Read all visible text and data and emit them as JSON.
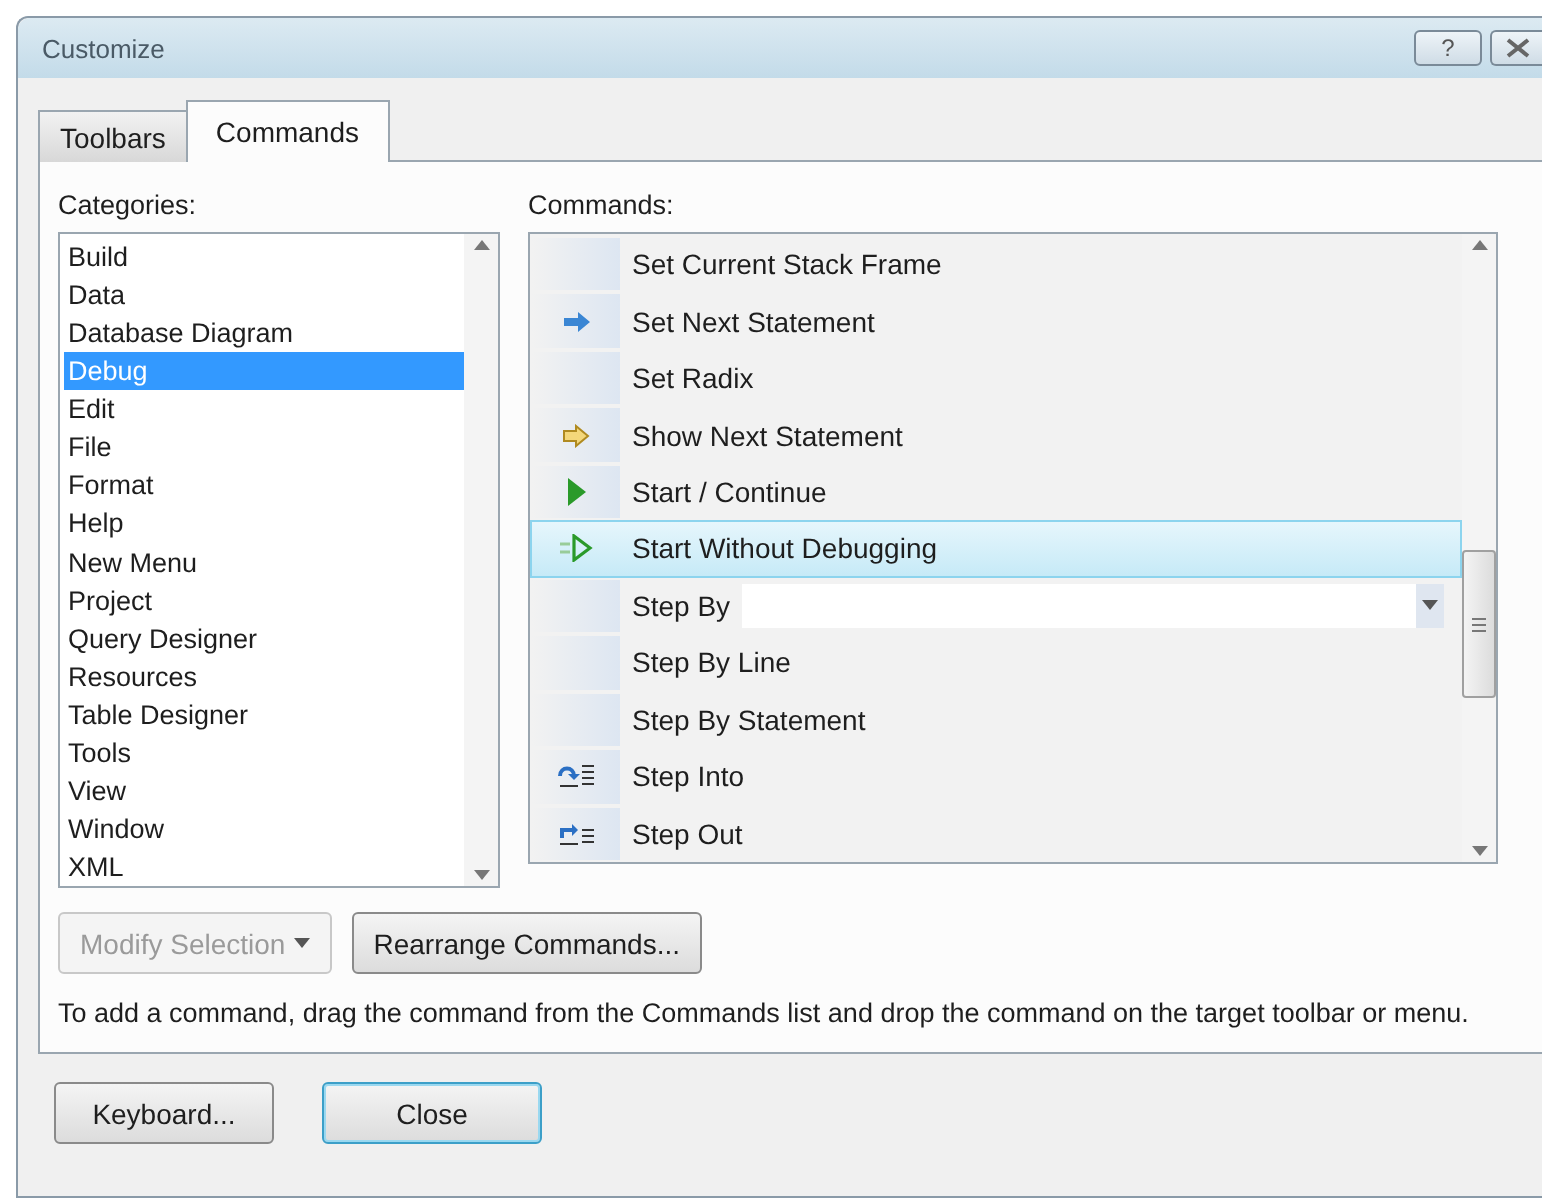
{
  "window": {
    "title": "Customize",
    "help_button": "?"
  },
  "tabs": [
    {
      "label": "Toolbars",
      "selected": false
    },
    {
      "label": "Commands",
      "selected": true
    }
  ],
  "categories": {
    "label": "Categories:",
    "items": [
      {
        "label": "Build",
        "selected": false
      },
      {
        "label": "Data",
        "selected": false
      },
      {
        "label": "Database Diagram",
        "selected": false
      },
      {
        "label": "Debug",
        "selected": true
      },
      {
        "label": "Edit",
        "selected": false
      },
      {
        "label": "File",
        "selected": false
      },
      {
        "label": "Format",
        "selected": false
      },
      {
        "label": "Help",
        "selected": false
      },
      {
        "label": "New Menu",
        "selected": false
      },
      {
        "label": "Project",
        "selected": false
      },
      {
        "label": "Query Designer",
        "selected": false
      },
      {
        "label": "Resources",
        "selected": false
      },
      {
        "label": "Table Designer",
        "selected": false
      },
      {
        "label": "Tools",
        "selected": false
      },
      {
        "label": "View",
        "selected": false
      },
      {
        "label": "Window",
        "selected": false
      },
      {
        "label": "XML",
        "selected": false
      }
    ]
  },
  "commands": {
    "label": "Commands:",
    "items": [
      {
        "label": "Set Current Stack Frame",
        "kind": "item",
        "selected": false
      },
      {
        "label": "Set Next Statement",
        "kind": "item",
        "selected": false
      },
      {
        "label": "Set Radix",
        "kind": "item",
        "selected": false
      },
      {
        "label": "Show Next Statement",
        "kind": "item",
        "selected": false
      },
      {
        "label": "Start / Continue",
        "kind": "item",
        "selected": false
      },
      {
        "label": "Start Without Debugging",
        "kind": "item",
        "selected": true
      },
      {
        "label": "Step By",
        "kind": "dropdown",
        "selected": false
      },
      {
        "label": "Step By Line",
        "kind": "item",
        "selected": false
      },
      {
        "label": "Step By Statement",
        "kind": "item",
        "selected": false
      },
      {
        "label": "Step Into",
        "kind": "item",
        "selected": false
      },
      {
        "label": "Step Out",
        "kind": "item",
        "selected": false
      }
    ]
  },
  "modify_button": {
    "label": "Modify Selection",
    "disabled": true
  },
  "rearrange_button": {
    "label": "Rearrange Commands..."
  },
  "hint": "To add a command, drag the command from the Commands list and drop the command on the target toolbar or menu.",
  "footer_buttons": [
    {
      "label": "Keyboard...",
      "default": false
    },
    {
      "label": "Close",
      "default": true
    }
  ]
}
